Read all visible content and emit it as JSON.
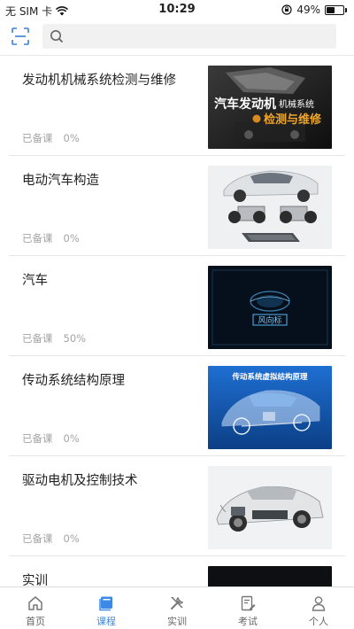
{
  "status_bar": {
    "carrier": "无 SIM 卡",
    "time": "10:29",
    "battery_percent": "49%",
    "battery_level": 0.49
  },
  "search": {
    "placeholder": ""
  },
  "courses": [
    {
      "title": "发动机机械系统检测与维修",
      "status": "已备课",
      "progress": "0%",
      "thumb_text_main": "汽车发动机",
      "thumb_text_sub": "机械系统",
      "thumb_text_line2": "检测与维修"
    },
    {
      "title": "电动汽车构造",
      "status": "已备课",
      "progress": "0%"
    },
    {
      "title": "汽车",
      "status": "已备课",
      "progress": "50%",
      "thumb_text_main": "风向标"
    },
    {
      "title": "传动系统结构原理",
      "status": "已备课",
      "progress": "0%",
      "thumb_text_main": "传动系统虚拟结构原理"
    },
    {
      "title": "驱动电机及控制技术",
      "status": "已备课",
      "progress": "0%"
    },
    {
      "title": "实训",
      "status": "",
      "progress": ""
    }
  ],
  "tabs": [
    {
      "label": "首页",
      "icon": "home-icon",
      "active": false
    },
    {
      "label": "课程",
      "icon": "course-book-icon",
      "active": true
    },
    {
      "label": "实训",
      "icon": "tools-icon",
      "active": false
    },
    {
      "label": "考试",
      "icon": "exam-icon",
      "active": false
    },
    {
      "label": "个人",
      "icon": "person-icon",
      "active": false
    }
  ],
  "colors": {
    "accent": "#3d8ae6",
    "meta_text": "#a4a4a4",
    "divider": "#e6e6e6"
  }
}
